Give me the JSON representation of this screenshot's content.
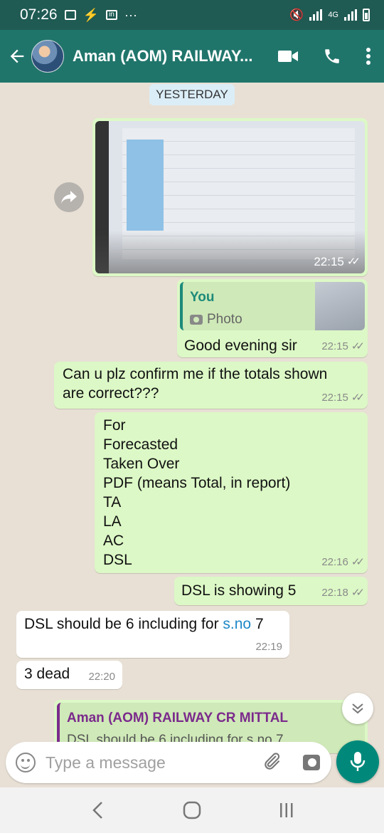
{
  "status_bar": {
    "time": "07:26",
    "more": "···",
    "network": "4G"
  },
  "header": {
    "contact_name": "Aman (AOM) RAILWAY...",
    "icons": [
      "back-arrow-icon",
      "video-call-icon",
      "phone-icon",
      "more-vert-icon"
    ]
  },
  "chat": {
    "date_chip": "YESTERDAY",
    "messages": [
      {
        "type": "image",
        "direction": "out",
        "time": "22:15",
        "ticks": "✓✓"
      },
      {
        "type": "reply",
        "direction": "out",
        "quote_author": "You",
        "quote_type": "Photo",
        "text": "Good evening sir",
        "time": "22:15",
        "ticks": "✓✓"
      },
      {
        "type": "text",
        "direction": "out",
        "lines": [
          "Can u plz confirm me if the totals shown",
          "are correct???"
        ],
        "time": "22:15",
        "ticks": "✓✓"
      },
      {
        "type": "text",
        "direction": "out",
        "lines": [
          "For",
          "Forecasted",
          "Taken Over",
          "PDF (means Total, in report)",
          "TA",
          "LA",
          "AC",
          "DSL"
        ],
        "time": "22:16",
        "ticks": "✓✓"
      },
      {
        "type": "text",
        "direction": "out",
        "text": "DSL is showing 5",
        "time": "22:18",
        "ticks": "✓✓"
      },
      {
        "type": "text",
        "direction": "in",
        "text_before_link": "DSL should be 6 including for ",
        "link": "s.no",
        "text_after_link": " 7",
        "time": "22:19"
      },
      {
        "type": "text",
        "direction": "in",
        "text": "3 dead",
        "time": "22:20"
      },
      {
        "type": "reply",
        "direction": "out",
        "quote_author": "Aman (AOM) RAILWAY CR MITTAL",
        "quote_text": "DSL should be 6 including for s.no 7"
      }
    ]
  },
  "compose": {
    "placeholder": "Type a message"
  },
  "colors": {
    "header": "#20756b",
    "status_bar": "#1f5a53",
    "outgoing_bubble": "#dcf8c6",
    "incoming_bubble": "#ffffff",
    "link": "#1e88c8",
    "mic_button": "#00897b"
  }
}
